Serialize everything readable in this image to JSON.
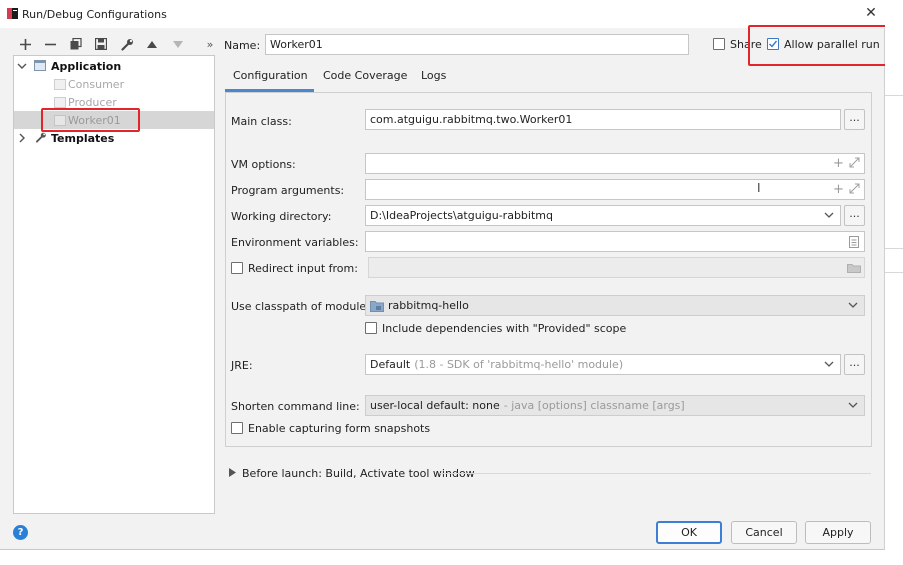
{
  "window": {
    "title": "Run/Debug Configurations"
  },
  "toolbar": {
    "expand_label": "»"
  },
  "name_field": {
    "label": "Name:",
    "value": "Worker01"
  },
  "share": {
    "label": "Share",
    "checked": false
  },
  "parallel": {
    "label": "Allow parallel run",
    "checked": true
  },
  "tree": {
    "application": "Application",
    "children": [
      "Consumer",
      "Producer",
      "Worker01"
    ],
    "templates": "Templates"
  },
  "tabs": [
    "Configuration",
    "Code Coverage",
    "Logs"
  ],
  "form": {
    "main_class_label": "Main class:",
    "main_class_value": "com.atguigu.rabbitmq.two.Worker01",
    "vm_options_label": "VM options:",
    "program_args_label": "Program arguments:",
    "working_dir_label": "Working directory:",
    "working_dir_value": "D:\\IdeaProjects\\atguigu-rabbitmq",
    "env_vars_label": "Environment variables:",
    "redirect_label": "Redirect input from:",
    "classpath_label": "Use classpath of module:",
    "classpath_value": "rabbitmq-hello",
    "include_deps_label": "Include dependencies with \"Provided\" scope",
    "jre_label": "JRE:",
    "jre_value": "Default",
    "jre_hint": "(1.8 - SDK of 'rabbitmq-hello' module)",
    "shorten_label": "Shorten command line:",
    "shorten_value": "user-local default: none",
    "shorten_hint": "- java [options] classname [args]",
    "snapshots_label": "Enable capturing form snapshots",
    "dots": "..."
  },
  "before_launch": "Before launch: Build, Activate tool window",
  "buttons": {
    "ok": "OK",
    "cancel": "Cancel",
    "apply": "Apply"
  },
  "help": "?",
  "colors": {
    "accent": "#3d7fd6",
    "highlight": "#e0252b"
  }
}
